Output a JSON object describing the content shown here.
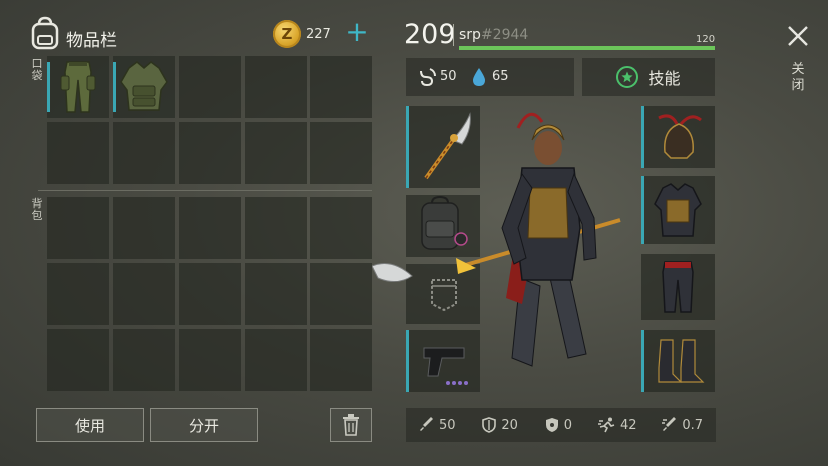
{
  "inventory": {
    "title": "物品栏",
    "pocket_label": "口袋",
    "backpack_label": "背包",
    "coins": "227",
    "coin_symbol": "Z",
    "pocket_items": [
      "pants-icon",
      "vest-icon"
    ],
    "icons": {
      "bag": "backpack-icon",
      "add": "plus-icon",
      "trash": "trash-icon"
    }
  },
  "actions": {
    "use_label": "使用",
    "split_label": "分开"
  },
  "player": {
    "level": "209",
    "name": "srp",
    "tag": "#2944",
    "xp_max": "120",
    "xp_fraction": 1.0,
    "food": "50",
    "water": "65",
    "skills_label": "技能"
  },
  "equipment": {
    "left_slots": [
      "glaive-icon",
      "backpack-icon",
      "pocket-icon",
      "pistol-icon"
    ],
    "right_slots": [
      "helmet-icon",
      "chest-armor-icon",
      "leg-armor-icon",
      "boots-icon"
    ]
  },
  "combat_stats": {
    "attack": "50",
    "defense": "20",
    "radiation": "0",
    "speed": "42",
    "attack_speed": "0.7"
  },
  "close": {
    "label": "关闭",
    "icon": "close-icon"
  },
  "colors": {
    "accent": "#3aa7b4",
    "xp": "#6cc55a",
    "skills_ring": "#4bc06b"
  }
}
